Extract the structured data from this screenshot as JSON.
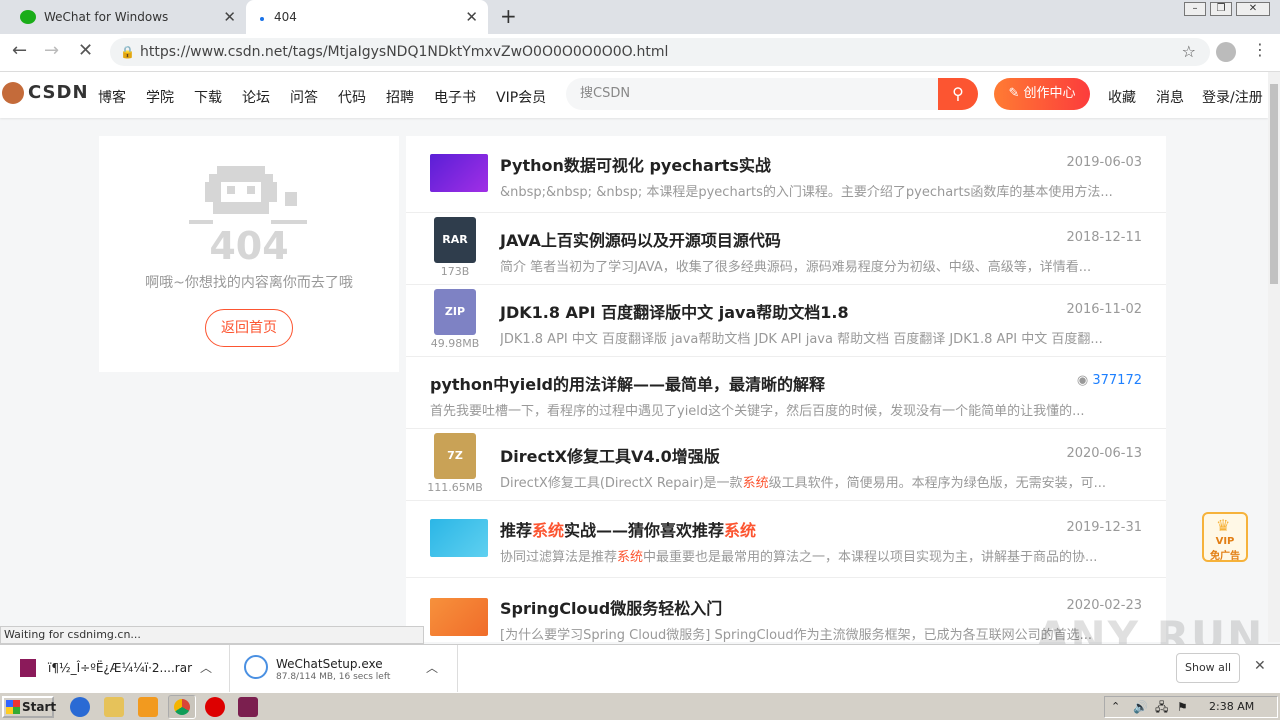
{
  "browser": {
    "tabs": [
      {
        "label": "WeChat for Windows"
      },
      {
        "label": "404"
      }
    ],
    "new_tab": "+",
    "url": "https://www.csdn.net/tags/MtjaIgysNDQ1NDktYmxvZwO0O0O0O0O0O.html",
    "status_text": "Waiting for csdnimg.cn...",
    "window_buttons": [
      "minimize",
      "restore",
      "close"
    ]
  },
  "csdn": {
    "logo_text": "CSDN",
    "nav": [
      "博客",
      "学院",
      "下载",
      "论坛",
      "问答",
      "代码",
      "招聘",
      "电子书",
      "VIP会员"
    ],
    "search_placeholder": "搜CSDN",
    "create_label": "创作中心",
    "right_links": [
      "收藏",
      "消息",
      "登录/注册"
    ]
  },
  "not_found": {
    "code": "404",
    "message": "啊哦~你想找的内容离你而去了哦",
    "button": "返回首页"
  },
  "results": [
    {
      "title": "Python数据可视化 pyecharts实战",
      "date": "2019-06-03",
      "desc": "&nbsp;&nbsp; &nbsp; 本课程是pyecharts的入门课程。主要介绍了pyecharts函数库的基本使用方法..."
    },
    {
      "title": "JAVA上百实例源码以及开源项目源代码",
      "date": "2018-12-11",
      "file_type": "RAR",
      "file_size": "173B",
      "desc": "简介 笔者当初为了学习JAVA，收集了很多经典源码，源码难易程度分为初级、中级、高级等，详情看..."
    },
    {
      "title": "JDK1.8 API 百度翻译版中文 java帮助文档1.8",
      "date": "2016-11-02",
      "file_type": "ZIP",
      "file_size": "49.98MB",
      "desc": "JDK1.8 API 中文 百度翻译版 java帮助文档 JDK API java 帮助文档 百度翻译 JDK1.8 API 中文 百度翻..."
    },
    {
      "title": "python中yield的用法详解——最简单，最清晰的解释",
      "views": "377172",
      "desc": "首先我要吐槽一下，看程序的过程中遇见了yield这个关键字，然后百度的时候，发现没有一个能简单的让我懂的..."
    },
    {
      "title": "DirectX修复工具V4.0增强版",
      "date": "2020-06-13",
      "file_type": "7Z",
      "file_size": "111.65MB",
      "desc_parts": [
        "DirectX修复工具(DirectX Repair)是一款",
        "系统",
        "级工具软件，简便易用。本程序为绿色版，无需安装，可..."
      ]
    },
    {
      "title_parts": [
        "推荐",
        "系统",
        "实战——猜你喜欢推荐",
        "系统"
      ],
      "date": "2019-12-31",
      "desc_parts": [
        "协同过滤算法是推荐",
        "系统",
        "中最重要也是最常用的算法之一，本课程以项目实现为主，讲解基于商品的协..."
      ]
    },
    {
      "title": "SpringCloud微服务轻松入门",
      "date": "2020-02-23",
      "desc": "[为什么要学习Spring Cloud微服务] SpringCloud作为主流微服务框架，已成为各互联网公司的首选..."
    }
  ],
  "vip_badge": {
    "line1": "VIP",
    "line2": "免广告"
  },
  "downloads": [
    {
      "name": "ï¶½_Î÷ºË¿Æ¼¼ï·2....rar"
    },
    {
      "name": "WeChatSetup.exe",
      "progress_text": "87.8/114 MB, 16 secs left"
    }
  ],
  "downloads_show_all": "Show all",
  "taskbar": {
    "start": "Start",
    "clock": "2:38 AM"
  },
  "watermark": "ANY RUN",
  "colors": {
    "accent": "#fc5531",
    "link": "#1e80ff"
  }
}
